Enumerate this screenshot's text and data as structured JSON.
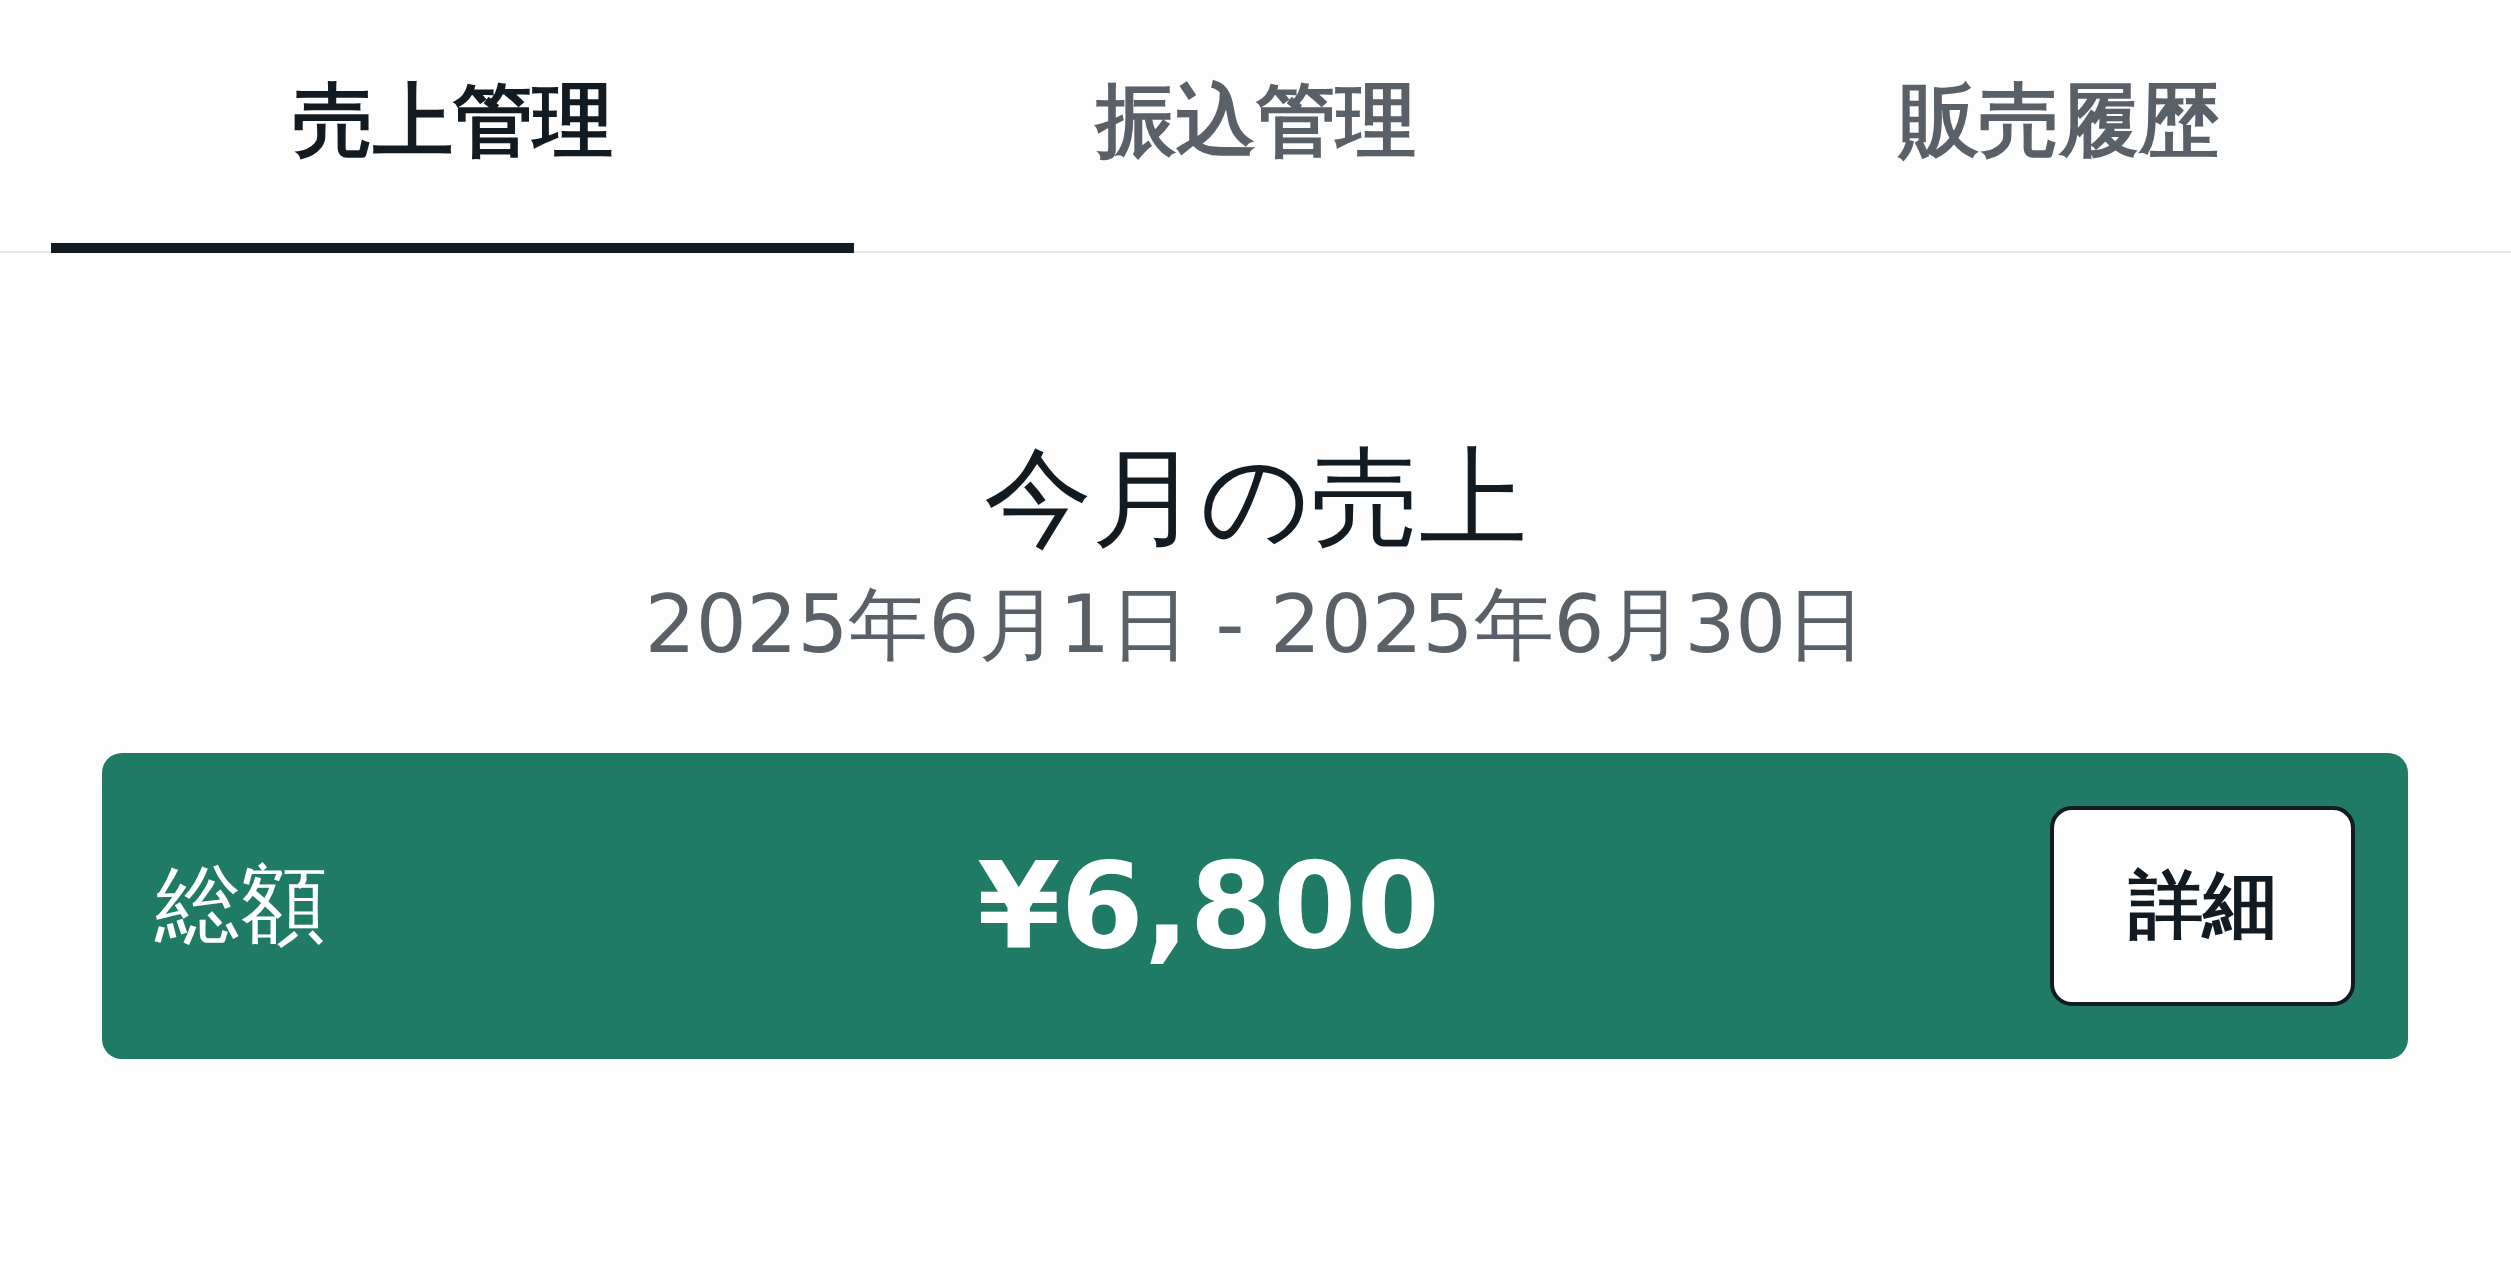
{
  "tabs": [
    {
      "label": "売上管理",
      "selected": true
    },
    {
      "label": "振込管理",
      "selected": false
    },
    {
      "label": "販売履歴",
      "selected": false
    }
  ],
  "summary": {
    "title": "今月の売上",
    "period": "2025年6月1日 - 2025年6月30日"
  },
  "total": {
    "label": "総額",
    "amount": "¥6,800",
    "button": "詳細"
  }
}
